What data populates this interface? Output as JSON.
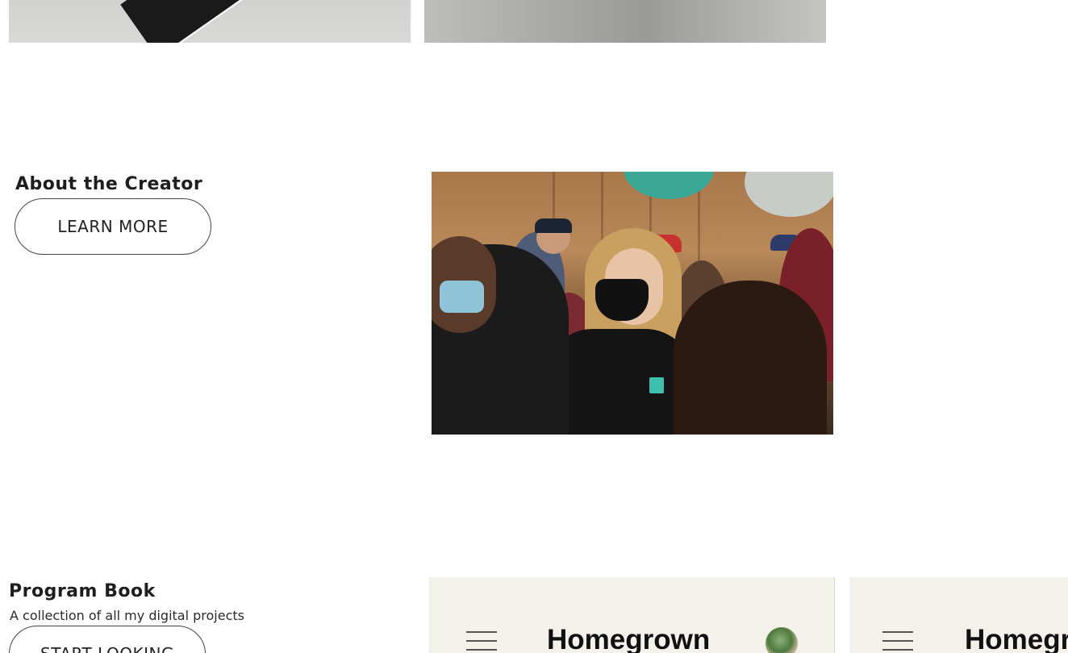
{
  "about": {
    "title": "About the Creator",
    "button_label": "LEARN MORE"
  },
  "program_book": {
    "title": "Program Book",
    "subtitle": "A collection of all my digital projects",
    "button_label": "START LOOKING"
  },
  "previews": [
    {
      "title": "Homegrown"
    },
    {
      "title": "Homegrown"
    }
  ]
}
